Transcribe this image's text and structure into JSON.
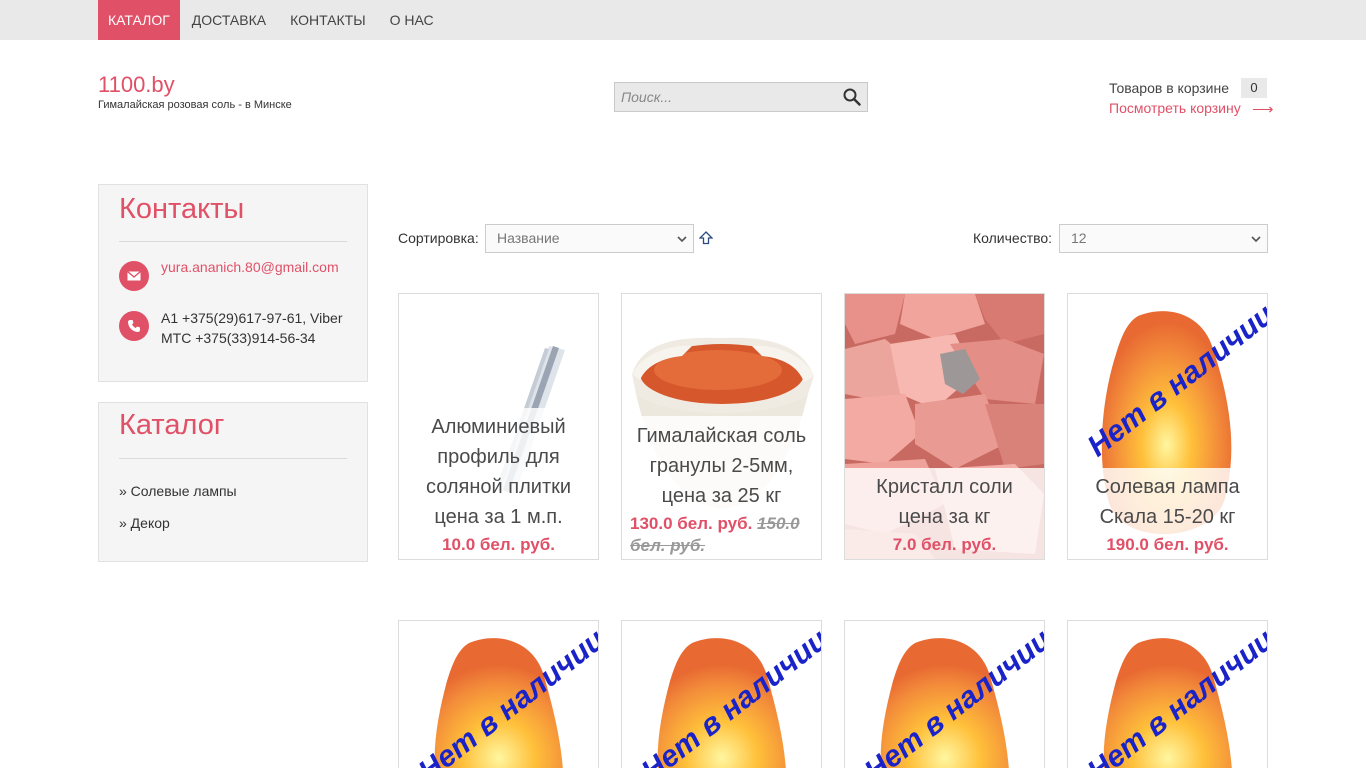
{
  "nav": {
    "items": [
      {
        "label": "КАТАЛОГ",
        "active": true
      },
      {
        "label": "ДОСТАВКА",
        "active": false
      },
      {
        "label": "КОНТАКТЫ",
        "active": false
      },
      {
        "label": "О НАС",
        "active": false
      }
    ]
  },
  "header": {
    "logo": "1100.by",
    "tagline": "Гималайская розовая соль - в Минске",
    "search_placeholder": "Поиск...",
    "cart_label": "Товаров в корзине",
    "cart_count": "0",
    "cart_link": "Посмотреть корзину",
    "cart_arrow": "⟶"
  },
  "contacts": {
    "title": "Контакты",
    "email": "yura.ananich.80@gmail.com",
    "phone": "A1 +375(29)617-97-61, Viber МТС +375(33)914-56-34"
  },
  "catalog": {
    "title": "Каталог",
    "items": [
      "» Солевые лампы",
      "» Декор"
    ]
  },
  "controls": {
    "sort_label": "Сортировка:",
    "sort_value": "Название",
    "count_label": "Количество:",
    "count_value": "12"
  },
  "products": [
    {
      "title": "Алюминиевый профиль для соляной плитки цена за 1 м.п.",
      "price": "10.0 бел. руб.",
      "image": "aluminium-profile"
    },
    {
      "title": "Гималайская соль гранулы 2-5мм, цена за 25 кг",
      "price": "130.0 бел. руб.",
      "old_price": "150.0 бел. руб.",
      "image": "salt-sack"
    },
    {
      "title": "Кристалл соли цена за кг",
      "price": "7.0 бел. руб.",
      "image": "salt-crystals"
    },
    {
      "title": "Солевая лампа Скала 15-20 кг",
      "price": "190.0 бел. руб.",
      "stamp": "Нет в наличии",
      "image": "salt-lamp"
    },
    {
      "stamp": "Нет в наличии",
      "image": "salt-lamp"
    },
    {
      "stamp": "Нет в наличии",
      "image": "salt-lamp"
    },
    {
      "stamp": "Нет в наличии",
      "image": "salt-lamp"
    },
    {
      "stamp": "Нет в наличии",
      "image": "salt-lamp"
    }
  ],
  "colors": {
    "accent": "#e05067",
    "stamp": "#1a23c8",
    "nav_bg": "#e9e9e9"
  }
}
